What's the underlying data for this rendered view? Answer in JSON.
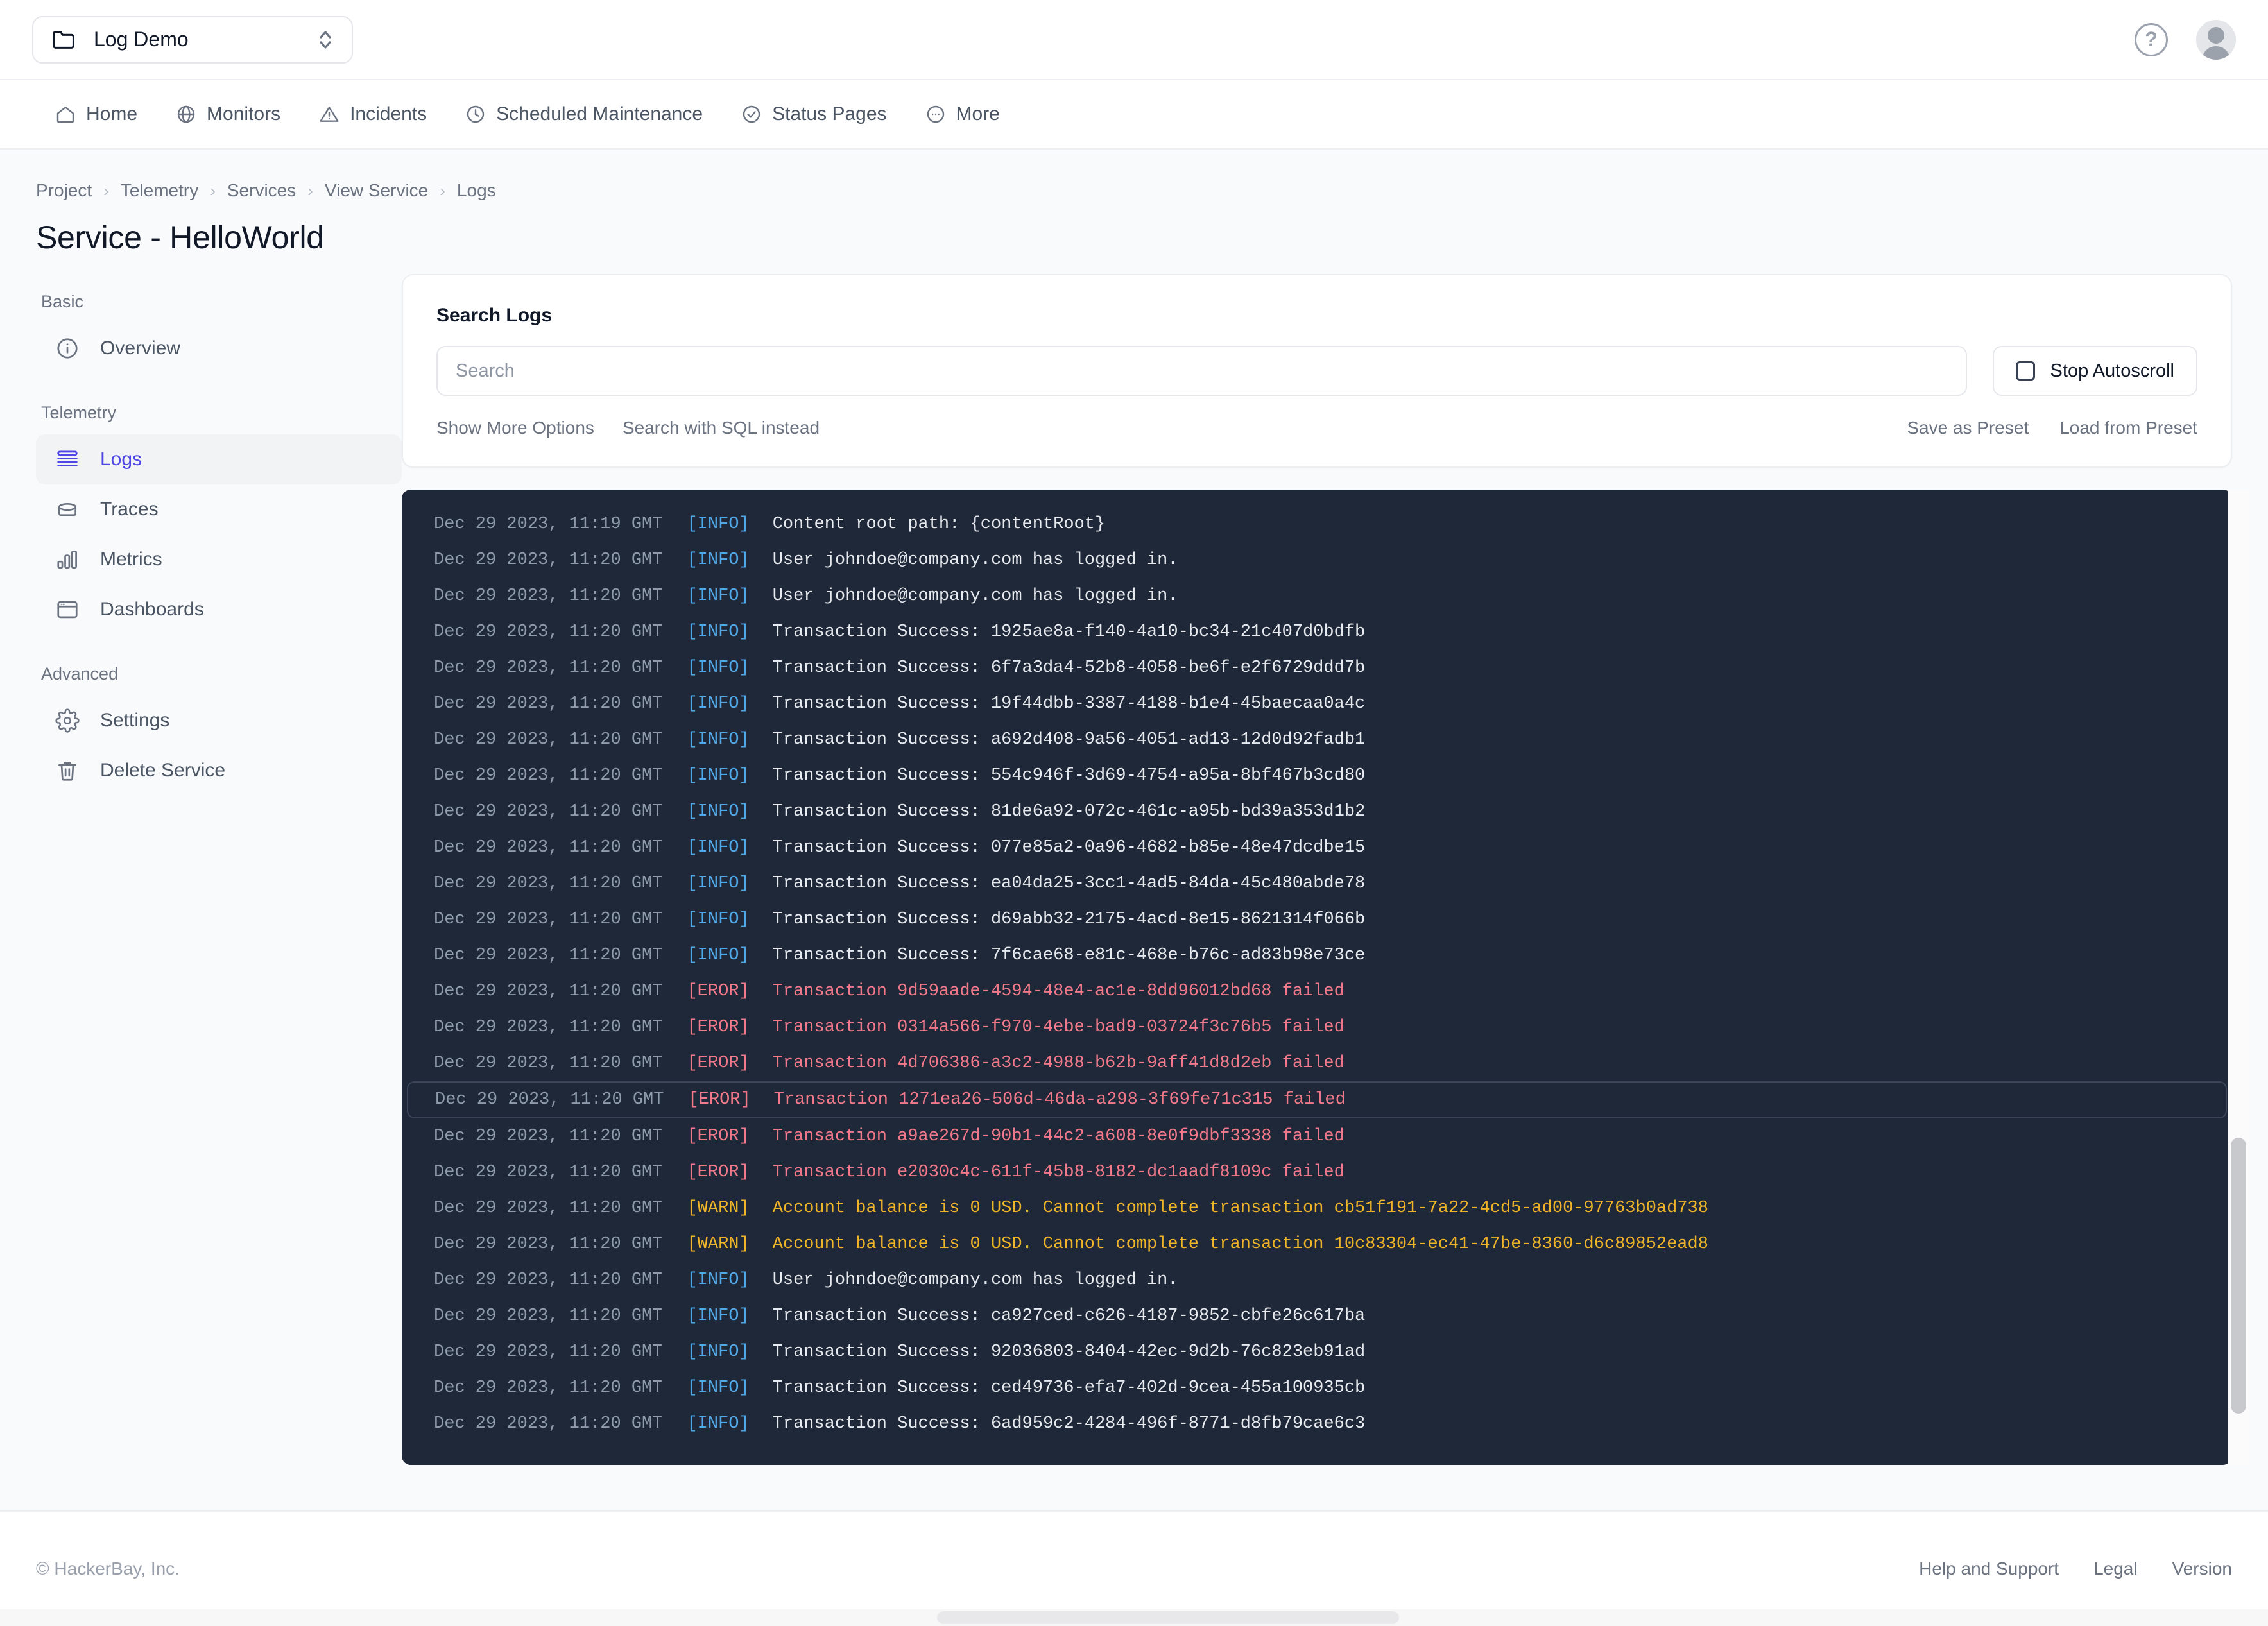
{
  "topbar": {
    "project_name": "Log Demo",
    "folder_icon": "folder-icon",
    "selector_icon": "chevron-up-down-icon",
    "help_icon": "help-circle-icon",
    "help_glyph": "?",
    "avatar_icon": "user-avatar-icon"
  },
  "nav": {
    "items": [
      {
        "label": "Home",
        "icon": "home-icon"
      },
      {
        "label": "Monitors",
        "icon": "globe-icon"
      },
      {
        "label": "Incidents",
        "icon": "alert-triangle-icon"
      },
      {
        "label": "Scheduled Maintenance",
        "icon": "clock-icon"
      },
      {
        "label": "Status Pages",
        "icon": "check-circle-icon"
      },
      {
        "label": "More",
        "icon": "ellipsis-circle-icon"
      }
    ]
  },
  "breadcrumb": {
    "items": [
      "Project",
      "Telemetry",
      "Services",
      "View Service",
      "Logs"
    ],
    "separator": "›"
  },
  "page_title": "Service - HelloWorld",
  "sidebar": {
    "groups": [
      {
        "heading": "Basic",
        "items": [
          {
            "label": "Overview",
            "icon": "info-circle-icon",
            "active": false
          }
        ]
      },
      {
        "heading": "Telemetry",
        "items": [
          {
            "label": "Logs",
            "icon": "logs-icon",
            "active": true
          },
          {
            "label": "Traces",
            "icon": "traces-icon",
            "active": false
          },
          {
            "label": "Metrics",
            "icon": "metrics-bar-icon",
            "active": false
          },
          {
            "label": "Dashboards",
            "icon": "dashboard-window-icon",
            "active": false
          }
        ]
      },
      {
        "heading": "Advanced",
        "items": [
          {
            "label": "Settings",
            "icon": "gear-icon",
            "active": false
          },
          {
            "label": "Delete Service",
            "icon": "trash-icon",
            "active": false
          }
        ]
      }
    ]
  },
  "search_card": {
    "title": "Search Logs",
    "search_placeholder": "Search",
    "search_value": "",
    "autoscroll_label": "Stop Autoscroll",
    "autoscroll_checked": false,
    "checkbox_icon": "checkbox-unchecked-icon",
    "show_more_options": "Show More Options",
    "search_with_sql": "Search with SQL instead",
    "save_as_preset": "Save as Preset",
    "load_from_preset": "Load from Preset"
  },
  "logs": {
    "accent_info": "#4fa8e8",
    "accent_error": "#f2798a",
    "accent_warn": "#f0b429",
    "panel_bg": "#1e2839",
    "rows": [
      {
        "time": "Dec 29 2023, 11:19 GMT",
        "level": "[INFO]",
        "type": "info",
        "message": "Content root path: {contentRoot}",
        "highlighted": false
      },
      {
        "time": "Dec 29 2023, 11:20 GMT",
        "level": "[INFO]",
        "type": "info",
        "message": "User johndoe@company.com has logged in.",
        "highlighted": false
      },
      {
        "time": "Dec 29 2023, 11:20 GMT",
        "level": "[INFO]",
        "type": "info",
        "message": "User johndoe@company.com has logged in.",
        "highlighted": false
      },
      {
        "time": "Dec 29 2023, 11:20 GMT",
        "level": "[INFO]",
        "type": "info",
        "message": "Transaction Success: 1925ae8a-f140-4a10-bc34-21c407d0bdfb",
        "highlighted": false
      },
      {
        "time": "Dec 29 2023, 11:20 GMT",
        "level": "[INFO]",
        "type": "info",
        "message": "Transaction Success: 6f7a3da4-52b8-4058-be6f-e2f6729ddd7b",
        "highlighted": false
      },
      {
        "time": "Dec 29 2023, 11:20 GMT",
        "level": "[INFO]",
        "type": "info",
        "message": "Transaction Success: 19f44dbb-3387-4188-b1e4-45baecaa0a4c",
        "highlighted": false
      },
      {
        "time": "Dec 29 2023, 11:20 GMT",
        "level": "[INFO]",
        "type": "info",
        "message": "Transaction Success: a692d408-9a56-4051-ad13-12d0d92fadb1",
        "highlighted": false
      },
      {
        "time": "Dec 29 2023, 11:20 GMT",
        "level": "[INFO]",
        "type": "info",
        "message": "Transaction Success: 554c946f-3d69-4754-a95a-8bf467b3cd80",
        "highlighted": false
      },
      {
        "time": "Dec 29 2023, 11:20 GMT",
        "level": "[INFO]",
        "type": "info",
        "message": "Transaction Success: 81de6a92-072c-461c-a95b-bd39a353d1b2",
        "highlighted": false
      },
      {
        "time": "Dec 29 2023, 11:20 GMT",
        "level": "[INFO]",
        "type": "info",
        "message": "Transaction Success: 077e85a2-0a96-4682-b85e-48e47dcdbe15",
        "highlighted": false
      },
      {
        "time": "Dec 29 2023, 11:20 GMT",
        "level": "[INFO]",
        "type": "info",
        "message": "Transaction Success: ea04da25-3cc1-4ad5-84da-45c480abde78",
        "highlighted": false
      },
      {
        "time": "Dec 29 2023, 11:20 GMT",
        "level": "[INFO]",
        "type": "info",
        "message": "Transaction Success: d69abb32-2175-4acd-8e15-8621314f066b",
        "highlighted": false
      },
      {
        "time": "Dec 29 2023, 11:20 GMT",
        "level": "[INFO]",
        "type": "info",
        "message": "Transaction Success: 7f6cae68-e81c-468e-b76c-ad83b98e73ce",
        "highlighted": false
      },
      {
        "time": "Dec 29 2023, 11:20 GMT",
        "level": "[EROR]",
        "type": "error",
        "message": "Transaction 9d59aade-4594-48e4-ac1e-8dd96012bd68 failed",
        "highlighted": false
      },
      {
        "time": "Dec 29 2023, 11:20 GMT",
        "level": "[EROR]",
        "type": "error",
        "message": "Transaction 0314a566-f970-4ebe-bad9-03724f3c76b5 failed",
        "highlighted": false
      },
      {
        "time": "Dec 29 2023, 11:20 GMT",
        "level": "[EROR]",
        "type": "error",
        "message": "Transaction 4d706386-a3c2-4988-b62b-9aff41d8d2eb failed",
        "highlighted": false
      },
      {
        "time": "Dec 29 2023, 11:20 GMT",
        "level": "[EROR]",
        "type": "error",
        "message": "Transaction 1271ea26-506d-46da-a298-3f69fe71c315 failed",
        "highlighted": true
      },
      {
        "time": "Dec 29 2023, 11:20 GMT",
        "level": "[EROR]",
        "type": "error",
        "message": "Transaction a9ae267d-90b1-44c2-a608-8e0f9dbf3338 failed",
        "highlighted": false
      },
      {
        "time": "Dec 29 2023, 11:20 GMT",
        "level": "[EROR]",
        "type": "error",
        "message": "Transaction e2030c4c-611f-45b8-8182-dc1aadf8109c failed",
        "highlighted": false
      },
      {
        "time": "Dec 29 2023, 11:20 GMT",
        "level": "[WARN]",
        "type": "warn",
        "message": "Account balance is 0 USD. Cannot complete transaction cb51f191-7a22-4cd5-ad00-97763b0ad738",
        "highlighted": false
      },
      {
        "time": "Dec 29 2023, 11:20 GMT",
        "level": "[WARN]",
        "type": "warn",
        "message": "Account balance is 0 USD. Cannot complete transaction 10c83304-ec41-47be-8360-d6c89852ead8",
        "highlighted": false
      },
      {
        "time": "Dec 29 2023, 11:20 GMT",
        "level": "[INFO]",
        "type": "info",
        "message": "User johndoe@company.com has logged in.",
        "highlighted": false
      },
      {
        "time": "Dec 29 2023, 11:20 GMT",
        "level": "[INFO]",
        "type": "info",
        "message": "Transaction Success: ca927ced-c626-4187-9852-cbfe26c617ba",
        "highlighted": false
      },
      {
        "time": "Dec 29 2023, 11:20 GMT",
        "level": "[INFO]",
        "type": "info",
        "message": "Transaction Success: 92036803-8404-42ec-9d2b-76c823eb91ad",
        "highlighted": false
      },
      {
        "time": "Dec 29 2023, 11:20 GMT",
        "level": "[INFO]",
        "type": "info",
        "message": "Transaction Success: ced49736-efa7-402d-9cea-455a100935cb",
        "highlighted": false
      },
      {
        "time": "Dec 29 2023, 11:20 GMT",
        "level": "[INFO]",
        "type": "info",
        "message": "Transaction Success: 6ad959c2-4284-496f-8771-d8fb79cae6c3",
        "highlighted": false
      }
    ]
  },
  "footer": {
    "copyright": "© HackerBay, Inc.",
    "links": [
      "Help and Support",
      "Legal",
      "Version"
    ]
  }
}
